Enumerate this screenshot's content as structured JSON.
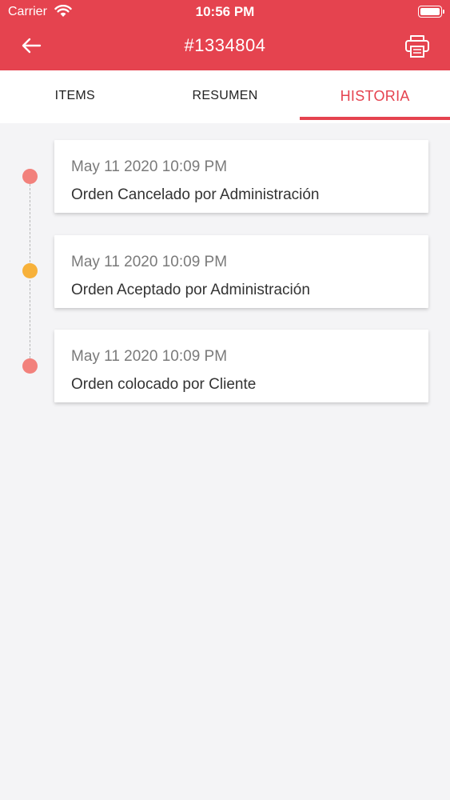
{
  "status_bar": {
    "carrier": "Carrier",
    "time": "10:56 PM"
  },
  "header": {
    "title": "#1334804",
    "back_icon": "arrow-left-icon",
    "print_icon": "printer-icon",
    "color": "#e5434f"
  },
  "tabs": [
    {
      "label": "ITEMS",
      "active": false
    },
    {
      "label": "RESUMEN",
      "active": false
    },
    {
      "label": "HISTORIA",
      "active": true
    }
  ],
  "history": [
    {
      "date": "May 11 2020 10:09 PM",
      "text": "Orden Cancelado por Administración",
      "dot_color": "#f2817c"
    },
    {
      "date": "May 11 2020 10:09 PM",
      "text": "Orden Aceptado por Administración",
      "dot_color": "#f7b13a"
    },
    {
      "date": "May 11 2020 10:09 PM",
      "text": "Orden colocado por Cliente",
      "dot_color": "#f2817c"
    }
  ]
}
